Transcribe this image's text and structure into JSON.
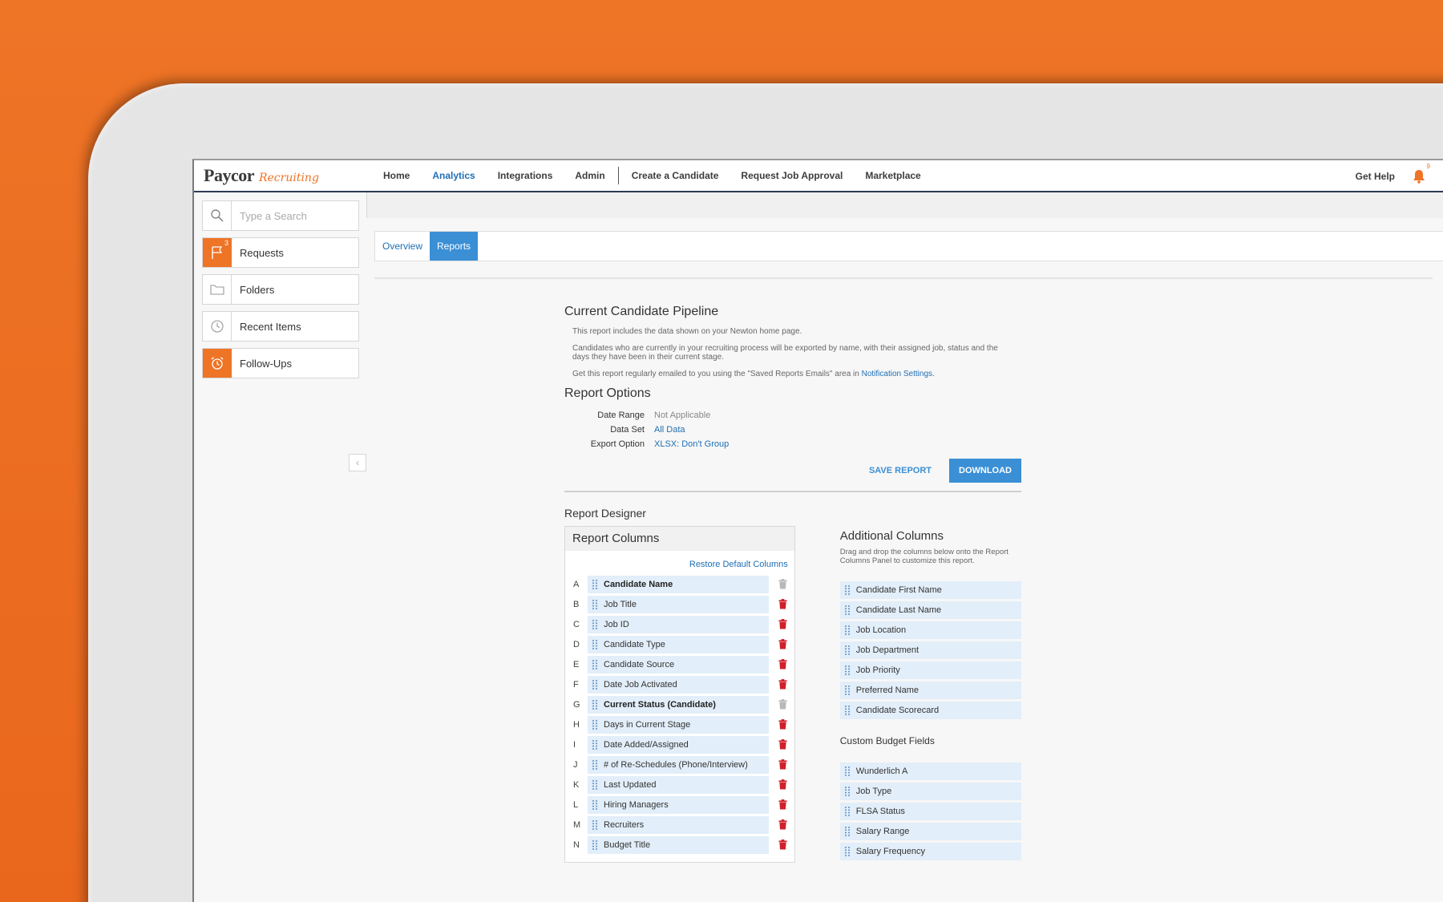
{
  "brand": {
    "name": "Paycor",
    "sub": "Recruiting"
  },
  "topnav": {
    "items": [
      {
        "label": "Home",
        "active": false
      },
      {
        "label": "Analytics",
        "active": true
      },
      {
        "label": "Integrations",
        "active": false
      },
      {
        "label": "Admin",
        "active": false
      },
      {
        "label": "Create a Candidate",
        "active": false
      },
      {
        "label": "Request Job Approval",
        "active": false
      },
      {
        "label": "Marketplace",
        "active": false
      }
    ],
    "get_help": "Get Help",
    "notification_count": "9"
  },
  "sidebar": {
    "search_placeholder": "Type a Search",
    "items": [
      {
        "label": "Requests",
        "icon": "flag-icon",
        "badge": "3"
      },
      {
        "label": "Folders",
        "icon": "folder-icon"
      },
      {
        "label": "Recent Items",
        "icon": "clock-icon"
      },
      {
        "label": "Follow-Ups",
        "icon": "alarm-clock-icon"
      }
    ]
  },
  "tabs": [
    {
      "label": "Overview",
      "active": false
    },
    {
      "label": "Reports",
      "active": true
    }
  ],
  "report": {
    "title": "Current Candidate Pipeline",
    "desc1": "This report includes the data shown on your Newton home page.",
    "desc2": "Candidates who are currently in your recruiting process will be exported by name, with their assigned job, status and the days they have been in their current stage.",
    "desc3": "Get this report regularly emailed to you using the \"Saved Reports Emails\" area in",
    "desc3_link": "Notification Settings",
    "desc3_end": "."
  },
  "options": {
    "title": "Report Options",
    "date_range_label": "Date Range",
    "date_range_value": "Not Applicable",
    "data_set_label": "Data Set",
    "data_set_value": "All Data",
    "export_label": "Export Option",
    "export_value": "XLSX: Don't Group",
    "save_label": "SAVE REPORT",
    "download_label": "DOWNLOAD"
  },
  "designer": {
    "title": "Report Designer",
    "columns_title": "Report Columns",
    "restore_label": "Restore Default Columns",
    "columns": [
      {
        "letter": "A",
        "label": "Candidate Name",
        "required": true
      },
      {
        "letter": "B",
        "label": "Job Title",
        "required": false
      },
      {
        "letter": "C",
        "label": "Job ID",
        "required": false
      },
      {
        "letter": "D",
        "label": "Candidate Type",
        "required": false
      },
      {
        "letter": "E",
        "label": "Candidate Source",
        "required": false
      },
      {
        "letter": "F",
        "label": "Date Job Activated",
        "required": false
      },
      {
        "letter": "G",
        "label": "Current Status (Candidate)",
        "required": true
      },
      {
        "letter": "H",
        "label": "Days in Current Stage",
        "required": false
      },
      {
        "letter": "I",
        "label": "Date Added/Assigned",
        "required": false
      },
      {
        "letter": "J",
        "label": "# of Re-Schedules (Phone/Interview)",
        "required": false
      },
      {
        "letter": "K",
        "label": "Last Updated",
        "required": false
      },
      {
        "letter": "L",
        "label": "Hiring Managers",
        "required": false
      },
      {
        "letter": "M",
        "label": "Recruiters",
        "required": false
      },
      {
        "letter": "N",
        "label": "Budget Title",
        "required": false
      }
    ],
    "additional_title": "Additional Columns",
    "additional_desc": "Drag and drop the columns below onto the Report Columns Panel to customize this report.",
    "additional": [
      "Candidate First Name",
      "Candidate Last Name",
      "Job Location",
      "Job Department",
      "Job Priority",
      "Preferred Name",
      "Candidate Scorecard"
    ],
    "custom_title": "Custom Budget Fields",
    "custom": [
      "Wunderlich A",
      "Job Type",
      "FLSA Status",
      "Salary Range",
      "Salary Frequency"
    ]
  },
  "colors": {
    "accent": "#ee7426",
    "link": "#1f6fb5",
    "button": "#3a8fd5",
    "trash": "#d0202a",
    "trash_disabled": "#b8b8b8"
  }
}
